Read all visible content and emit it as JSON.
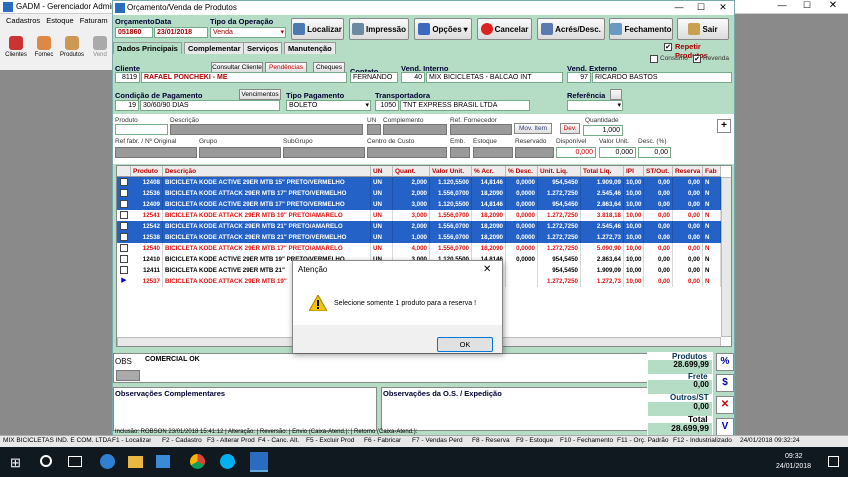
{
  "main_window": {
    "title": "GADM - Gerenciador Administ",
    "menu": [
      "Cadastros",
      "Estoque",
      "Faturam"
    ],
    "icons": [
      {
        "label": "Clientes",
        "color": "#c33"
      },
      {
        "label": "Fornec",
        "color": "#d84"
      },
      {
        "label": "Produtos",
        "color": "#c95"
      },
      {
        "label": "Vend",
        "color": "#888"
      }
    ]
  },
  "dialog": {
    "title": "Orçamento/Venda de Produtos",
    "toolbar": {
      "localizar": "Localizar",
      "impressao": "Impressão",
      "opcoes": "Opções",
      "cancelar": "Cancelar",
      "acres_desc": "Acrés/Desc.",
      "fechamento": "Fechamento",
      "sair": "Sair"
    },
    "labels": {
      "orcamento": "Orçamento",
      "data": "Data",
      "tipo_operacao": "Tipo da Operação",
      "cliente": "Cliente",
      "contato": "Contato",
      "vend_interno": "Vend. Interno",
      "vend_externo": "Vend. Externo",
      "cond_pag": "Condição de Pagamento",
      "tipo_pag": "Tipo Pagamento",
      "transportadora": "Transportadora",
      "referencia": "Referência",
      "consumo": "Consumo",
      "revenda": "Revenda",
      "repetir": "Repetir Produtos"
    },
    "values": {
      "orcamento": "051860",
      "data": "23/01/2018",
      "tipo_operacao": "Venda",
      "cliente_cod": "8119",
      "cliente_nome": "RAFAEL PONCHEKI - ME",
      "contato": "FERNANDO",
      "vend_int_cod": "40",
      "vend_int_nome": "MIX BICICLETAS - BALCAO INT",
      "vend_ext_cod": "97",
      "vend_ext_nome": "RICARDO BASTOS",
      "cond_cod": "19",
      "cond_desc": "30/60/90 DIAS",
      "tipo_pag": "BOLETO",
      "transp_cod": "1050",
      "transp_nome": "TNT EXPRESS BRASIL LTDA"
    },
    "tabs": [
      "Dados Principais",
      "Complementar",
      "Serviços",
      "Manutenção"
    ],
    "small_buttons": {
      "consultar_cliente": "Consultar Cliente",
      "pendencias": "Pendências",
      "cheques": "Cheques",
      "vencimentos": "Vencimentos",
      "mov_item": "Mov. Item",
      "dev": "Dev."
    },
    "product_labels": {
      "produto": "Produto",
      "descricao": "Descrição",
      "un": "UN",
      "complemento": "Complemento",
      "ref_fornecedor": "Ref. Fornecedor",
      "quantidade": "Quantidade",
      "ref_fabr": "Ref fabr. / Nº Original",
      "grupo": "Grupo",
      "subgrupo": "SubGrupo",
      "centro_custo": "Centro de Custo",
      "emb": "Emb.",
      "estoque": "Estoque",
      "reservado": "Reservado",
      "disponivel": "Disponível",
      "valor_unit": "Valor Unit.",
      "desc_pct": "Desc. (%)"
    },
    "product_values": {
      "quantidade": "1,000",
      "disponivel": "0,000",
      "valor_unit": "0,000",
      "desc_pct": "0,00"
    },
    "columns": [
      "Produto",
      "Descrição",
      "UN",
      "Quant.",
      "Valor Unit.",
      "% Acr.",
      "% Desc.",
      "Unit. Liq.",
      "Total Liq.",
      "IPI",
      "ST/Out.",
      "Reserva",
      "Fab"
    ],
    "rows": [
      {
        "check": "✔",
        "produto": "12408",
        "descricao": "BICICLETA KODE ACTIVE 29ER MTB 15\" PRETO/VERMELHO",
        "un": "UN",
        "quant": "2,000",
        "valor": "1.120,5500",
        "acr": "14,8146",
        "desc": "0,0000",
        "unit": "954,5450",
        "total": "1.909,09",
        "ipi": "10,00",
        "st": "0,00",
        "reserva": "0,00",
        "fab": "N",
        "style": "sel"
      },
      {
        "check": "✔",
        "produto": "12536",
        "descricao": "BICICLETA KODE ATTACK 29ER MTB 17\" PRETO/VERMELHO",
        "un": "UN",
        "quant": "2,000",
        "valor": "1.556,0700",
        "acr": "18,2090",
        "desc": "0,0000",
        "unit": "1.272,7250",
        "total": "2.545,46",
        "ipi": "10,00",
        "st": "0,00",
        "reserva": "0,00",
        "fab": "N",
        "style": "sel"
      },
      {
        "check": "✔",
        "produto": "12409",
        "descricao": "BICICLETA KODE ACTIVE 29ER MTB 17\" PRETO/VERMELHO",
        "un": "UN",
        "quant": "3,000",
        "valor": "1.120,5500",
        "acr": "14,8146",
        "desc": "0,0000",
        "unit": "954,5450",
        "total": "2.863,64",
        "ipi": "10,00",
        "st": "0,00",
        "reserva": "0,00",
        "fab": "N",
        "style": "sel"
      },
      {
        "check": "",
        "produto": "12541",
        "descricao": "BICICLETA KODE ATTACK 29ER MTB 19\" PRETO/AMARELO",
        "un": "UN",
        "quant": "3,000",
        "valor": "1.556,0700",
        "acr": "18,2090",
        "desc": "0,0000",
        "unit": "1.272,7250",
        "total": "3.818,18",
        "ipi": "10,00",
        "st": "0,00",
        "reserva": "0,00",
        "fab": "N",
        "style": "red"
      },
      {
        "check": "✔",
        "produto": "12542",
        "descricao": "BICICLETA KODE ATTACK 29ER MTB 21\" PRETO/AMARELO",
        "un": "UN",
        "quant": "2,000",
        "valor": "1.556,0700",
        "acr": "18,2090",
        "desc": "0,0000",
        "unit": "1.272,7250",
        "total": "2.545,46",
        "ipi": "10,00",
        "st": "0,00",
        "reserva": "0,00",
        "fab": "N",
        "style": "sel"
      },
      {
        "check": "✔",
        "produto": "12538",
        "descricao": "BICICLETA KODE ATTACK 29ER MTB 21\" PRETO/VERMELHO",
        "un": "UN",
        "quant": "1,000",
        "valor": "1.556,0700",
        "acr": "18,2090",
        "desc": "0,0000",
        "unit": "1.272,7250",
        "total": "1.272,73",
        "ipi": "10,00",
        "st": "0,00",
        "reserva": "0,00",
        "fab": "N",
        "style": "sel"
      },
      {
        "check": "",
        "produto": "12540",
        "descricao": "BICICLETA KODE ATTACK 29ER MTB 17\" PRETO/AMARELO",
        "un": "UN",
        "quant": "4,000",
        "valor": "1.556,0700",
        "acr": "18,2090",
        "desc": "0,0000",
        "unit": "1.272,7250",
        "total": "5.090,90",
        "ipi": "10,00",
        "st": "0,00",
        "reserva": "0,00",
        "fab": "N",
        "style": "red"
      },
      {
        "check": "",
        "produto": "12410",
        "descricao": "BICICLETA KODE ACTIVE 29ER MTB 19\" PRETO/VERMELHO",
        "un": "UN",
        "quant": "3,000",
        "valor": "1.120,5500",
        "acr": "14,8146",
        "desc": "0,0000",
        "unit": "954,5450",
        "total": "2.863,64",
        "ipi": "10,00",
        "st": "0,00",
        "reserva": "0,00",
        "fab": "N",
        "style": "norm"
      },
      {
        "check": "",
        "produto": "12411",
        "descricao": "BICICLETA KODE ACTIVE 29ER MTB 21\"",
        "un": "",
        "quant": "",
        "valor": "",
        "acr": "",
        "desc": "",
        "unit": "954,5450",
        "total": "1.909,09",
        "ipi": "10,00",
        "st": "0,00",
        "reserva": "0,00",
        "fab": "N",
        "style": "norm"
      },
      {
        "check": "▶",
        "produto": "12537",
        "descricao": "BICICLETA KODE ATTACK 29ER MTB 19\"",
        "un": "",
        "quant": "",
        "valor": "",
        "acr": "",
        "desc": "",
        "unit": "1.272,7250",
        "total": "1.272,73",
        "ipi": "10,00",
        "st": "0,00",
        "reserva": "0,00",
        "fab": "N",
        "style": "red"
      }
    ],
    "obs_label": "OBS",
    "obs_text": "COMERCIAL OK",
    "obs_comp_label": "Observações Complementares",
    "obs_os_label": "Observações da O.S. / Expedição",
    "totals": {
      "produtos_label": "Produtos",
      "produtos": "28.699,99",
      "frete_label": "Frete",
      "frete": "0,00",
      "outros_label": "Outros/ST",
      "outros": "0,00",
      "total_label": "Total",
      "total": "28.699,99"
    },
    "inclusao": "Inclusão: ROBSON 23/01/2018 15:41:12 | Alteração: | Reversão: | Envio (Caixa-Atend.): | Retorno (Caixa-Atend.):"
  },
  "fkeys": [
    "F1 - Localizar",
    "F2 - Cadastro",
    "F3 - Alterar Prod",
    "F4 - Canc. Alt.",
    "F5 - Excluir Prod",
    "F6 - Fabricar",
    "F7 - Vendas Perd",
    "F8 - Reserva",
    "F9 - Estoque",
    "F10 - Fechamento",
    "F11 - Orç. Padrão",
    "F12 - Industrializado"
  ],
  "status_bar": {
    "company": "MIX BICICLETAS IND. E COM. LTDA",
    "datetime": "24/01/2018 09:32:24"
  },
  "modal": {
    "title": "Atenção",
    "message": "Selecione somente 1 produto para a reserva !",
    "ok": "OK"
  },
  "taskbar": {
    "time": "09:32",
    "date": "24/01/2018"
  }
}
